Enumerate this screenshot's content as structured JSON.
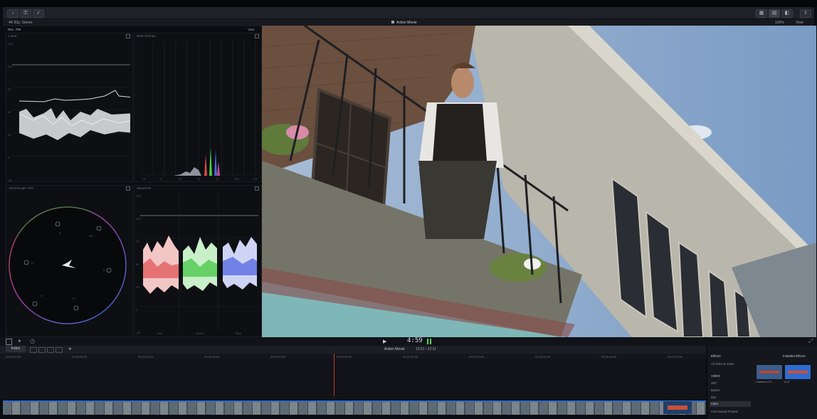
{
  "toolbar": {
    "import_icon": "download-icon",
    "keywords_icon": "key-icon",
    "background_tasks_icon": "check-circle-icon",
    "layout_icons": [
      "grid-view-icon",
      "timeline-view-icon",
      "inspector-icon"
    ],
    "share_icon": "share-icon"
  },
  "infobar": {
    "format": "4K 60p, Stereo",
    "project_title": "Action Movie",
    "zoom": "100%",
    "view_label": "View"
  },
  "scopes": {
    "color_space": "Rec. 709",
    "view_label": "View",
    "luma": {
      "title": "Luma",
      "ticks": [
        "120",
        "100",
        "75",
        "50",
        "25",
        "0",
        "-20"
      ]
    },
    "histogram": {
      "title": "RGB Overlay",
      "ticks": [
        "-25",
        "0",
        "25",
        "50",
        "75",
        "100",
        "125"
      ]
    },
    "vectorscope": {
      "title": "Vectorscope 75%",
      "labels": [
        "R",
        "MG",
        "B",
        "CY",
        "G",
        "YL"
      ]
    },
    "waveform": {
      "title": "Waveform",
      "ticks": [
        "120",
        "100",
        "75",
        "50",
        "25",
        "0",
        "-20"
      ],
      "channels": [
        "Red",
        "Green",
        "Blue"
      ]
    }
  },
  "transport": {
    "timecode": "4:59"
  },
  "timeline": {
    "index_label": "Index",
    "project_title": "Action Movie",
    "duration": "10:51 / 32:31",
    "ruler_marks": [
      "00:00:00:00",
      "00:00:05:00",
      "00:00:10:00",
      "00:00:15:00",
      "00:00:20:00",
      "00:00:25:00",
      "00:00:30:00",
      "00:00:35:00",
      "00:00:40:00",
      "00:00:45:00",
      "00:00:50:00"
    ]
  },
  "effects": {
    "title": "Effects",
    "installed": "Installed Effects",
    "categories": [
      "All Video & Audio",
      "VIDEO",
      "360°",
      "Basics",
      "Blur",
      "Color",
      "Color Board Presets"
    ],
    "selected": "Color",
    "thumbnails": [
      "Custom LUT",
      "LUT"
    ]
  },
  "colors": {
    "accent": "#4a8fe0",
    "timecode_green": "#5fd35f",
    "playhead": "#c0392b"
  }
}
